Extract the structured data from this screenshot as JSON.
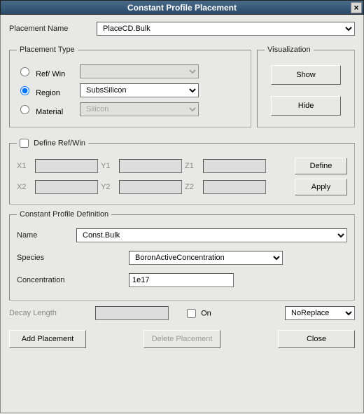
{
  "title": "Constant Profile Placement",
  "placement_name_label": "Placement Name",
  "placement_name_value": "PlaceCD.Bulk",
  "placement_type": {
    "legend": "Placement Type",
    "refwin": {
      "label": "Ref/ Win",
      "value": "",
      "checked": false
    },
    "region": {
      "label": "Region",
      "value": "SubsSilicon",
      "checked": true
    },
    "material": {
      "label": "Material",
      "value": "Silicon",
      "checked": false
    }
  },
  "visualization": {
    "legend": "Visualization",
    "show": "Show",
    "hide": "Hide"
  },
  "define_refwin": {
    "legend_checkbox_label": "Define Ref/Win",
    "checked": false,
    "x1": "X1",
    "y1": "Y1",
    "z1": "Z1",
    "x2": "X2",
    "y2": "Y2",
    "z2": "Z2",
    "x1v": "",
    "y1v": "",
    "z1v": "",
    "x2v": "",
    "y2v": "",
    "z2v": "",
    "define_btn": "Define",
    "apply_btn": "Apply"
  },
  "profile": {
    "legend": "Constant Profile Definition",
    "name_label": "Name",
    "name_value": "Const.Bulk",
    "species_label": "Species",
    "species_value": "BoronActiveConcentration",
    "conc_label": "Concentration",
    "conc_value": "1e17"
  },
  "decay": {
    "label": "Decay Length",
    "value": "",
    "on_label": "On",
    "on_checked": false,
    "replace_value": "NoReplace"
  },
  "buttons": {
    "add": "Add Placement",
    "delete": "Delete Placement",
    "close": "Close"
  }
}
